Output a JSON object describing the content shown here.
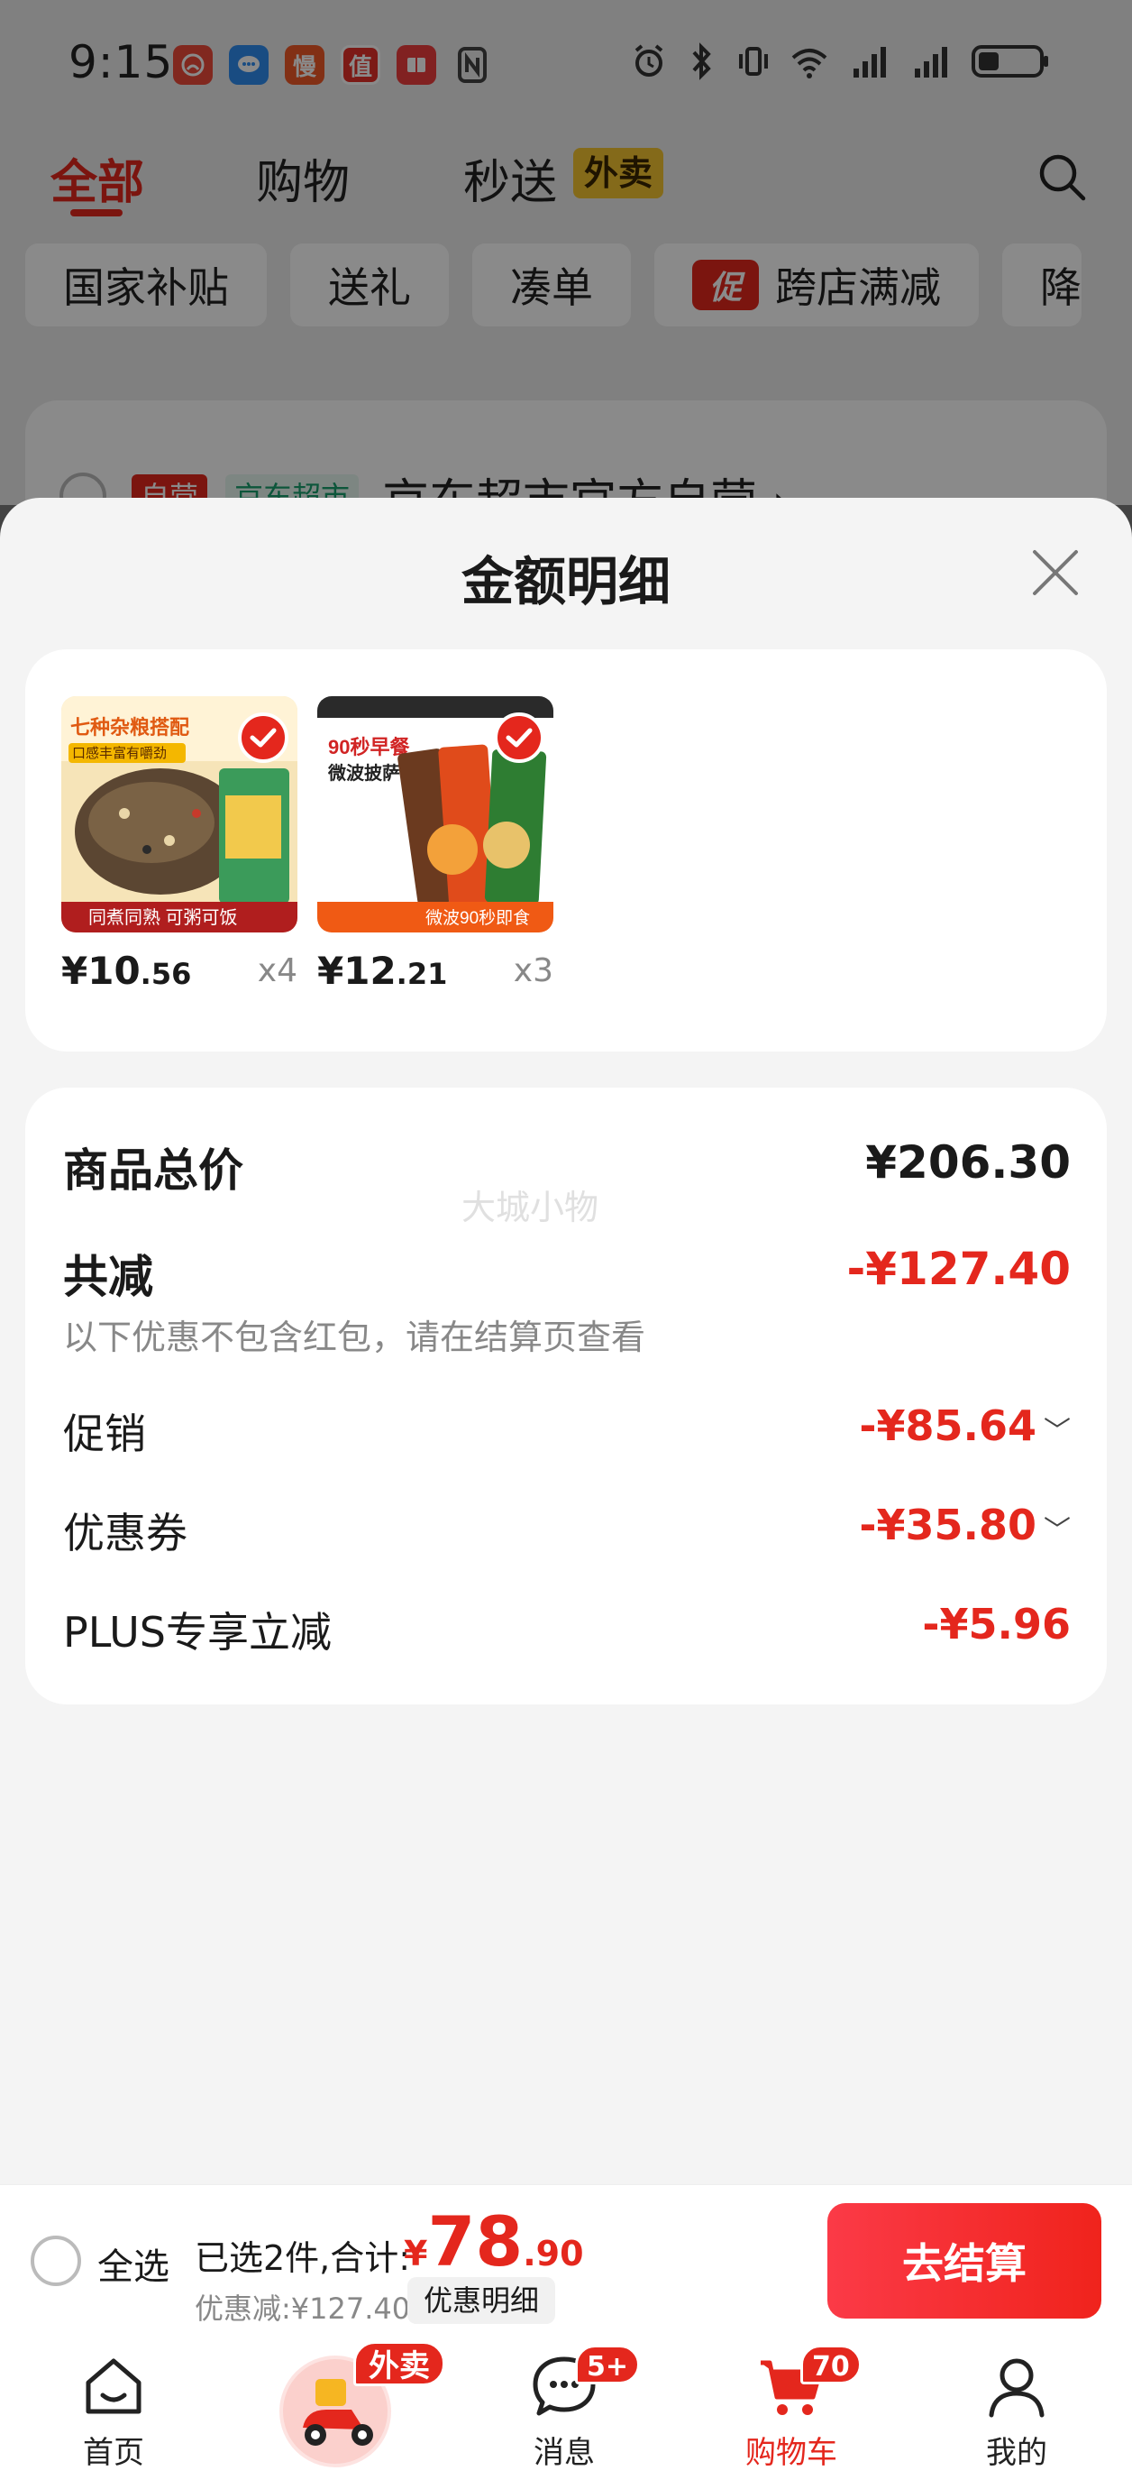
{
  "status_bar": {
    "time": "9:15",
    "app_icons": [
      {
        "name": "app-icon-red",
        "glyph": "",
        "color": "#ef4b3a"
      },
      {
        "name": "app-icon-blue",
        "glyph": "",
        "color": "#2f8cf0"
      },
      {
        "name": "app-icon-man",
        "glyph": "慢",
        "color": "#f05a28"
      },
      {
        "name": "app-icon-zhi",
        "glyph": "值",
        "color": "#e5302a"
      },
      {
        "name": "app-icon-book",
        "glyph": "",
        "color": "#ef3e3e"
      }
    ]
  },
  "top_nav": {
    "tabs": [
      "全部",
      "购物",
      "秒送"
    ],
    "waimai_pill": "外卖"
  },
  "chips": [
    "国家补贴",
    "送礼",
    "凑单",
    "跨店满减",
    "降"
  ],
  "chip_promo_badge": "促",
  "store": {
    "tag1": "自营",
    "tag2": "京东超市",
    "name": "京东超市官方自营 ›"
  },
  "sheet": {
    "title": "金额明细",
    "products": [
      {
        "price_int": "¥10",
        "price_dec": ".56",
        "qty": "x4",
        "headline": "七种杂粮搭配",
        "sub": "口感丰富有嚼劲",
        "bottom": "同煮同熟 可粥可饭"
      },
      {
        "price_int": "¥12",
        "price_dec": ".21",
        "qty": "x3",
        "headline": "90秒早餐",
        "sub": "微波披萨",
        "bottom": "微波90秒即食"
      }
    ],
    "watermark": "大城小物",
    "rows": {
      "total_label": "商品总价",
      "total_value": "¥206.30",
      "reduce_label": "共减",
      "reduce_value": "-¥127.40",
      "reduce_note": "以下优惠不包含红包，请在结算页查看",
      "promo_label": "促销",
      "promo_value": "-¥85.64",
      "coupon_label": "优惠券",
      "coupon_value": "-¥35.80",
      "plus_label": "PLUS专享立减",
      "plus_value": "-¥5.96"
    }
  },
  "settle": {
    "select_all": "全选",
    "selected_text": "已选2件,合计:",
    "total_currency": "¥",
    "total_int": "78",
    "total_dec": ".90",
    "discount_text": "优惠减:¥127.40",
    "detail_link": "优惠明细",
    "checkout": "去结算"
  },
  "tabbar": {
    "items": [
      "首页",
      "消息",
      "购物车",
      "我的"
    ],
    "waimai_badge": "外卖",
    "message_badge": "5+",
    "cart_badge": "70"
  },
  "colors": {
    "accent": "#e4271d",
    "checkout_gradient_start": "#fb3a47",
    "checkout_gradient_end": "#f0231c"
  }
}
